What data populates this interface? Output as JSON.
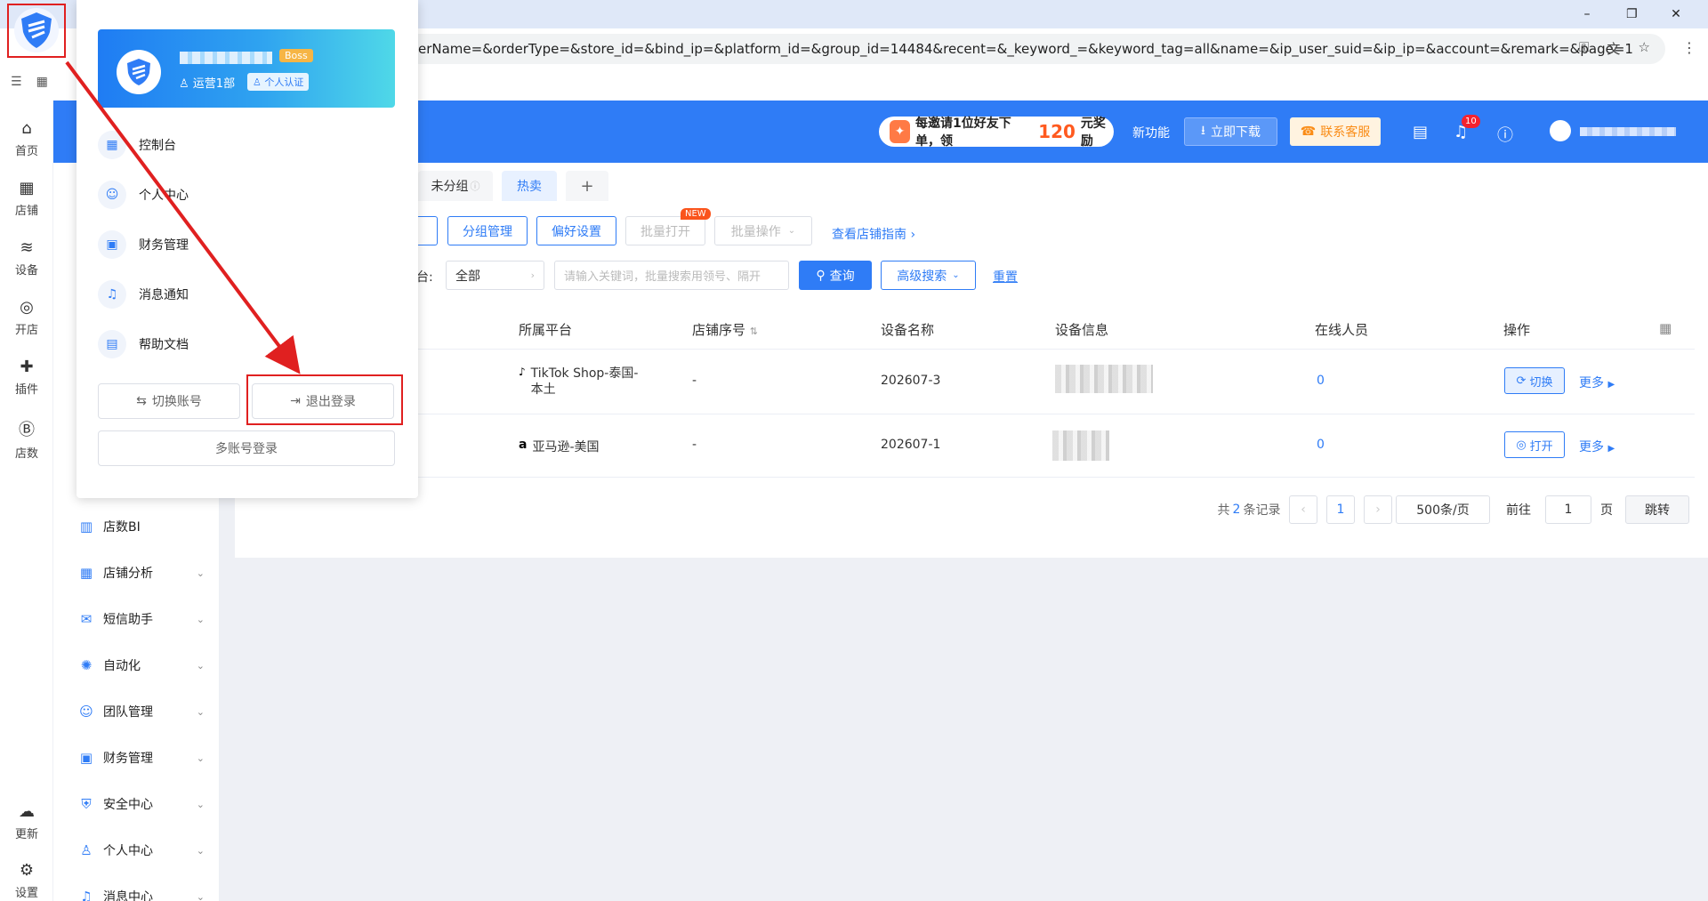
{
  "browser": {
    "url": "erName=&orderType=&store_id=&bind_ip=&platform_id=&group_id=14484&recent=&_keyword_=&keyword_tag=all&name=&ip_user_suid=&ip_ip=&account=&remark=&page=1",
    "win_min": "–",
    "win_restore": "❐",
    "win_close": "✕"
  },
  "header": {
    "promo_text": "每邀请1位好友下单，领",
    "promo_amount": "120",
    "promo_suffix": "元奖励",
    "new_feature": "新功能",
    "download": "立即下载",
    "customer_service": "联系客服",
    "notification_count": "10"
  },
  "rail": [
    {
      "icon": "⌂",
      "label": "首页"
    },
    {
      "icon": "▦",
      "label": "店铺"
    },
    {
      "icon": "≋",
      "label": "设备"
    },
    {
      "icon": "◎",
      "label": "开店"
    },
    {
      "icon": "✚",
      "label": "插件"
    },
    {
      "icon": "Ⓑ",
      "label": "店数"
    },
    {
      "icon": "☁",
      "label": "更新"
    },
    {
      "icon": "⚙",
      "label": "设置"
    }
  ],
  "leftnav": [
    {
      "icon": "▥",
      "label": "店数BI"
    },
    {
      "icon": "▦",
      "label": "店铺分析"
    },
    {
      "icon": "✉",
      "label": "短信助手"
    },
    {
      "icon": "✺",
      "label": "自动化"
    },
    {
      "icon": "☺",
      "label": "团队管理"
    },
    {
      "icon": "▣",
      "label": "财务管理"
    },
    {
      "icon": "⛨",
      "label": "安全中心"
    },
    {
      "icon": "♙",
      "label": "个人中心"
    },
    {
      "icon": "♫",
      "label": "消息中心"
    }
  ],
  "tabs": {
    "ungrouped": "未分组",
    "hot": "热卖",
    "add": "+"
  },
  "toolbar": {
    "group_manage": "分组管理",
    "preferences": "偏好设置",
    "batch_open": "批量打开",
    "batch_ops": "批量操作",
    "new_tag": "NEW",
    "guide": "查看店铺指南"
  },
  "filter": {
    "platform_label": "台:",
    "platform_value": "全部",
    "keyword_placeholder": "请输入关键词，批量搜索用领号、隔开",
    "query": "查询",
    "advanced": "高级搜索",
    "reset": "重置"
  },
  "table": {
    "headers": [
      "所属平台",
      "店铺序号",
      "设备名称",
      "设备信息",
      "在线人员",
      "操作"
    ],
    "rows": [
      {
        "platform_icon": "♪",
        "platform": "TikTok Shop-泰国-",
        "platform2": "本土",
        "seq": "-",
        "device": "202607-3",
        "online": "0",
        "action": "切换",
        "more": "更多"
      },
      {
        "platform_icon": "a",
        "platform": "亚马逊-美国",
        "platform2": "",
        "seq": "-",
        "device": "202607-1",
        "online": "0",
        "action": "打开",
        "more": "更多"
      }
    ]
  },
  "pager": {
    "total_prefix": "共",
    "total": "2",
    "total_suffix": "条记录",
    "page": "1",
    "page_size": "500条/页",
    "goto": "前往",
    "goto_value": "1",
    "page_unit": "页",
    "jump": "跳转"
  },
  "popup": {
    "boss": "Boss",
    "department": "运营1部",
    "certification": "个人认证",
    "menu": [
      {
        "icon": "▦",
        "label": "控制台"
      },
      {
        "icon": "☺",
        "label": "个人中心"
      },
      {
        "icon": "▣",
        "label": "财务管理"
      },
      {
        "icon": "♫",
        "label": "消息通知"
      },
      {
        "icon": "▤",
        "label": "帮助文档"
      }
    ],
    "switch_account": "切换账号",
    "logout": "退出登录",
    "multi_login": "多账号登录"
  }
}
